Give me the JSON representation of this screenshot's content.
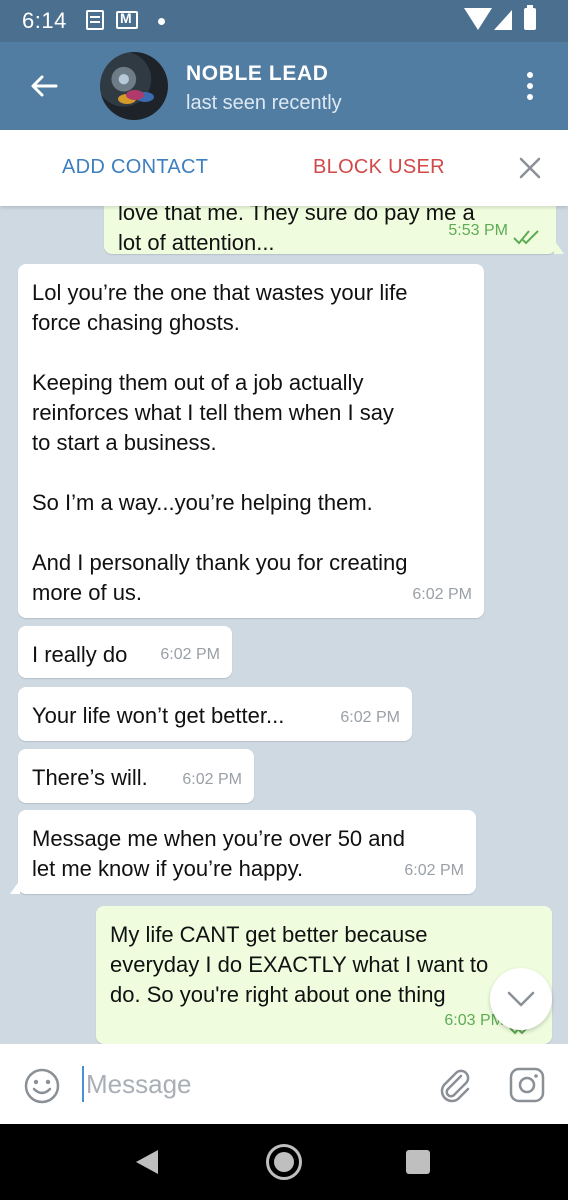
{
  "status_bar": {
    "time": "6:14"
  },
  "header": {
    "contact_name": "NOBLE LEAD",
    "contact_status": "last seen recently"
  },
  "action_bar": {
    "add_contact": "ADD CONTACT",
    "block_user": "BLOCK USER"
  },
  "messages": [
    {
      "direction": "out",
      "text": "love that me. They sure do pay me a\nlot of attention...",
      "time": "5:53 PM",
      "read": true
    },
    {
      "direction": "in",
      "text": "Lol you’re the one that wastes your life\nforce chasing ghosts.\n\nKeeping them out of a job actually\nreinforces what I tell them when I say\nto start a business.\n\nSo I’m a way...you’re helping them.\n\nAnd I personally thank you for creating\nmore of us.",
      "time": "6:02 PM"
    },
    {
      "direction": "in",
      "text": "I really do",
      "time": "6:02 PM"
    },
    {
      "direction": "in",
      "text": "Your life won’t get better...",
      "time": "6:02 PM"
    },
    {
      "direction": "in",
      "text": "There’s will.",
      "time": "6:02 PM"
    },
    {
      "direction": "in",
      "text": "Message me when you’re over 50 and\nlet me know if you’re happy.",
      "time": "6:02 PM"
    },
    {
      "direction": "out",
      "text": "My life CANT get better because\neveryday I do EXACTLY what I want to\ndo. So you're right about one thing",
      "time": "6:03 PM",
      "read": true
    }
  ],
  "input": {
    "placeholder": "Message"
  },
  "colors": {
    "header": "#527da3",
    "status_bar": "#4a6f8f",
    "chat_bg": "#cfd9e2",
    "incoming_bubble": "#ffffff",
    "outgoing_bubble": "#effdde",
    "add_contact": "#3d7fbf",
    "block_user": "#d24949"
  },
  "icons": [
    "back-arrow-icon",
    "more-vertical-icon",
    "close-icon",
    "double-check-icon",
    "chevron-down-icon",
    "emoji-icon",
    "paperclip-icon",
    "camera-icon"
  ]
}
